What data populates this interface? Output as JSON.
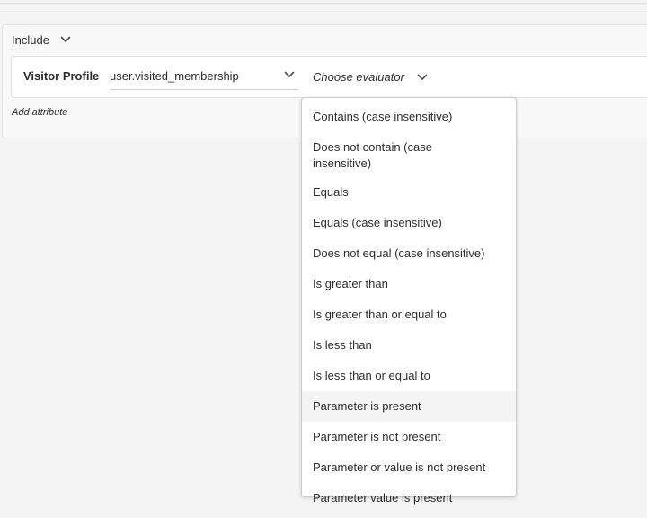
{
  "include": {
    "label": "Include"
  },
  "rule": {
    "label": "Visitor Profile",
    "attribute_value": "user.visited_membership",
    "evaluator_placeholder": "Choose evaluator"
  },
  "add_attribute_label": "Add attribute",
  "evaluator_options": [
    "Contains (case insensitive)",
    "Does not contain (case insensitive)",
    "Equals",
    "Equals (case insensitive)",
    "Does not equal (case insensitive)",
    "Is greater than",
    "Is greater than or equal to",
    "Is less than",
    "Is less than or equal to",
    "Parameter is present",
    "Parameter is not present",
    "Parameter or value is not present",
    "Parameter value is present"
  ],
  "highlighted_option": "Parameter is present",
  "icons": {
    "chevron": "chevron-down-icon"
  },
  "colors": {
    "text": "#2c2c2c",
    "highlight": "#f4f4f4",
    "panel": "#f8f8f8"
  }
}
